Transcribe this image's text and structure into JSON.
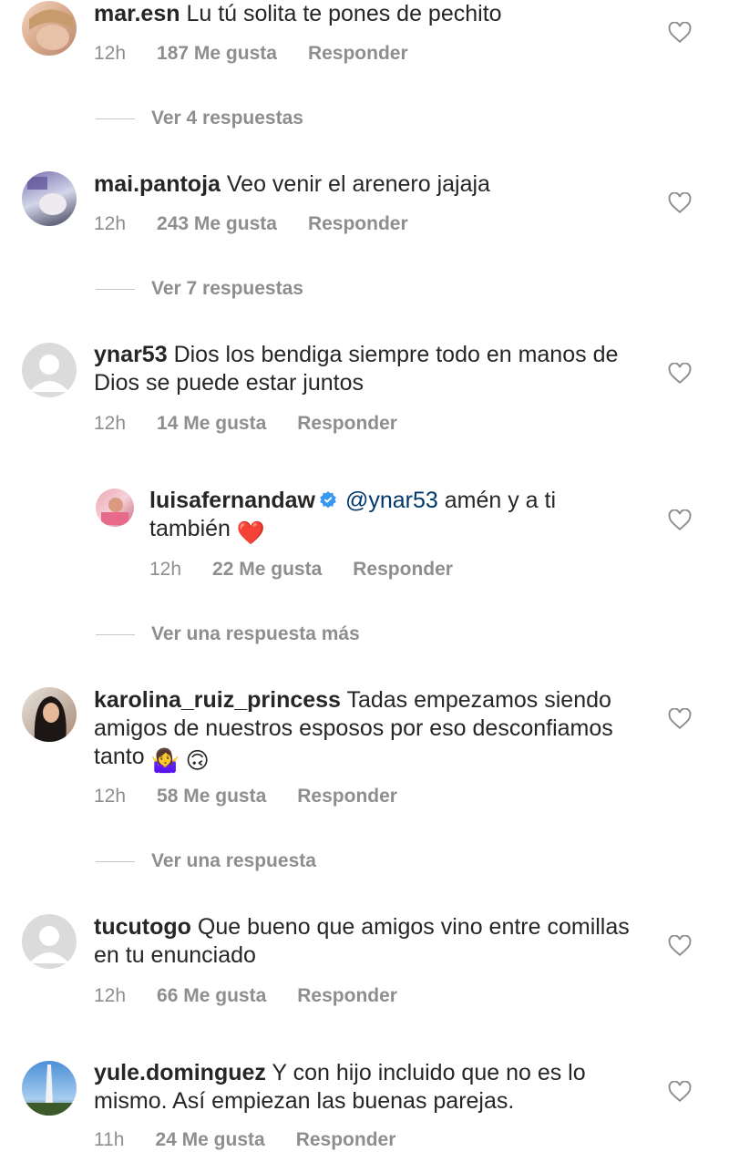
{
  "comments": [
    {
      "user": "mar.esn",
      "text": "Lu tú solita te pones de pechito",
      "time": "12h",
      "likes": "187 Me gusta",
      "reply": "Responder",
      "view_replies": "Ver 4 respuestas"
    },
    {
      "user": "mai.pantoja",
      "text": "Veo venir el arenero jajaja",
      "time": "12h",
      "likes": "243 Me gusta",
      "reply": "Responder",
      "view_replies": "Ver 7 respuestas"
    },
    {
      "user": "ynar53",
      "text": "Dios los bendiga siempre todo en manos de Dios se puede estar juntos",
      "time": "12h",
      "likes": "14 Me gusta",
      "reply": "Responder",
      "reply_item": {
        "user": "luisafernandaw",
        "mention": "@ynar53",
        "text": "amén y a ti también",
        "emoji": "❤️",
        "time": "12h",
        "likes": "22 Me gusta",
        "reply": "Responder"
      },
      "view_replies": "Ver una respuesta más"
    },
    {
      "user": "karolina_ruiz_princess",
      "text": "Tadas empezamos siendo amigos de nuestros esposos por eso desconfiamos tanto",
      "emoji": "🤷‍♀️ 🙃",
      "time": "12h",
      "likes": "58 Me gusta",
      "reply": "Responder",
      "view_replies": "Ver una respuesta"
    },
    {
      "user": "tucutogo",
      "text": "Que bueno que amigos vino entre comillas en tu enunciado",
      "time": "12h",
      "likes": "66 Me gusta",
      "reply": "Responder"
    },
    {
      "user": "yule.dominguez",
      "text": "Y con hijo incluido que no es lo mismo. Así empiezan las buenas parejas.",
      "time": "11h",
      "likes": "24 Me gusta",
      "reply": "Responder"
    }
  ]
}
